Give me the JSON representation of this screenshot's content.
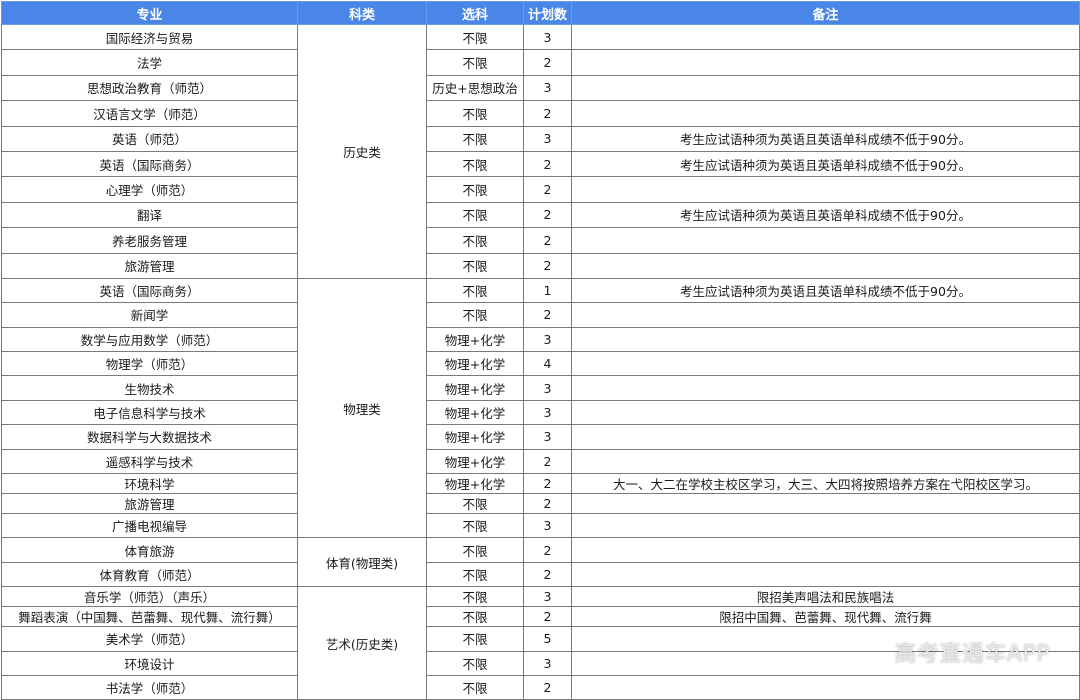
{
  "headers": {
    "major": "专业",
    "category": "科类",
    "subjects": "选科",
    "plan": "计划数",
    "note": "备注"
  },
  "groups": {
    "history": "历史类",
    "physics": "物理类",
    "sports": "体育(物理类)",
    "art": "艺术(历史类)"
  },
  "rows": [
    {
      "major": "国际经济与贸易",
      "subjects": "不限",
      "plan": "3",
      "note": ""
    },
    {
      "major": "法学",
      "subjects": "不限",
      "plan": "2",
      "note": ""
    },
    {
      "major": "思想政治教育（师范）",
      "subjects": "历史+思想政治",
      "plan": "3",
      "note": ""
    },
    {
      "major": "汉语言文学（师范）",
      "subjects": "不限",
      "plan": "2",
      "note": ""
    },
    {
      "major": "英语（师范）",
      "subjects": "不限",
      "plan": "3",
      "note": "考生应试语种须为英语且英语单科成绩不低于90分。"
    },
    {
      "major": "英语（国际商务）",
      "subjects": "不限",
      "plan": "2",
      "note": "考生应试语种须为英语且英语单科成绩不低于90分。"
    },
    {
      "major": "心理学（师范）",
      "subjects": "不限",
      "plan": "2",
      "note": ""
    },
    {
      "major": "翻译",
      "subjects": "不限",
      "plan": "2",
      "note": "考生应试语种须为英语且英语单科成绩不低于90分。"
    },
    {
      "major": "养老服务管理",
      "subjects": "不限",
      "plan": "2",
      "note": ""
    },
    {
      "major": "旅游管理",
      "subjects": "不限",
      "plan": "2",
      "note": ""
    },
    {
      "major": "英语（国际商务）",
      "subjects": "不限",
      "plan": "1",
      "note": "考生应试语种须为英语且英语单科成绩不低于90分。"
    },
    {
      "major": "新闻学",
      "subjects": "不限",
      "plan": "2",
      "note": ""
    },
    {
      "major": "数学与应用数学（师范）",
      "subjects": "物理+化学",
      "plan": "3",
      "note": ""
    },
    {
      "major": "物理学（师范）",
      "subjects": "物理+化学",
      "plan": "4",
      "note": ""
    },
    {
      "major": "生物技术",
      "subjects": "物理+化学",
      "plan": "3",
      "note": ""
    },
    {
      "major": "电子信息科学与技术",
      "subjects": "物理+化学",
      "plan": "3",
      "note": ""
    },
    {
      "major": "数据科学与大数据技术",
      "subjects": "物理+化学",
      "plan": "3",
      "note": ""
    },
    {
      "major": "遥感科学与技术",
      "subjects": "物理+化学",
      "plan": "2",
      "note": ""
    },
    {
      "major": "环境科学",
      "subjects": "物理+化学",
      "plan": "2",
      "note": "大一、大二在学校主校区学习，大三、大四将按照培养方案在弋阳校区学习。"
    },
    {
      "major": "旅游管理",
      "subjects": "不限",
      "plan": "2",
      "note": ""
    },
    {
      "major": "广播电视编导",
      "subjects": "不限",
      "plan": "3",
      "note": ""
    },
    {
      "major": "体育旅游",
      "subjects": "不限",
      "plan": "2",
      "note": ""
    },
    {
      "major": "体育教育（师范）",
      "subjects": "不限",
      "plan": "2",
      "note": ""
    },
    {
      "major": "音乐学（师范）（声乐）",
      "subjects": "不限",
      "plan": "3",
      "note": "限招美声唱法和民族唱法"
    },
    {
      "major": "舞蹈表演（中国舞、芭蕾舞、现代舞、流行舞）",
      "subjects": "不限",
      "plan": "2",
      "note": "限招中国舞、芭蕾舞、现代舞、流行舞"
    },
    {
      "major": "美术学（师范）",
      "subjects": "不限",
      "plan": "5",
      "note": ""
    },
    {
      "major": "环境设计",
      "subjects": "不限",
      "plan": "3",
      "note": ""
    },
    {
      "major": "书法学（师范）",
      "subjects": "不限",
      "plan": "2",
      "note": ""
    }
  ],
  "watermark": "高考直通车APP"
}
